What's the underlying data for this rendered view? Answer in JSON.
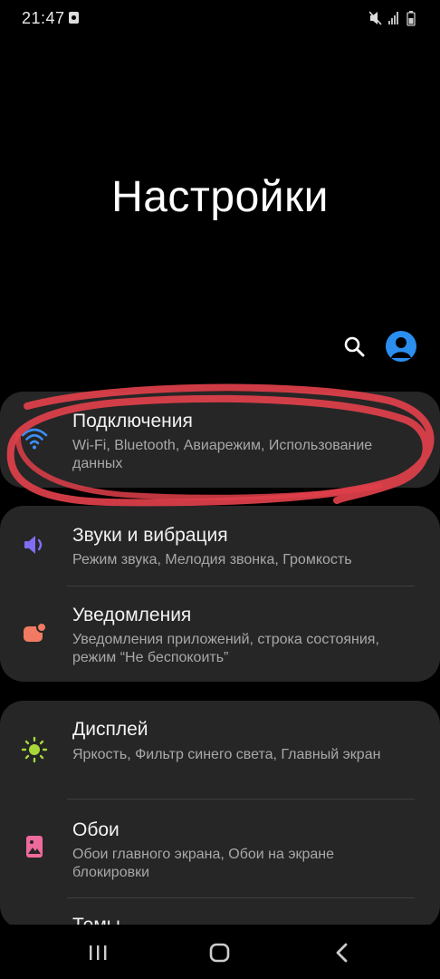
{
  "status_bar": {
    "time": "21:47"
  },
  "title": "Настройки",
  "header": {
    "search_icon": "search-icon",
    "account_icon": "account-icon"
  },
  "items": [
    {
      "title": "Подключения",
      "subtitle": "Wi-Fi, Bluetooth, Авиарежим, Использование данных",
      "icon": "wifi-icon",
      "icon_color": "#3d8ef5"
    },
    {
      "title": "Звуки и вибрация",
      "subtitle": "Режим звука, Мелодия звонка, Громкость",
      "icon": "volume-icon",
      "icon_color": "#7f6df2"
    },
    {
      "title": "Уведомления",
      "subtitle": "Уведомления приложений, строка состояния, режим “Не беспокоить”",
      "icon": "notifications-icon",
      "icon_color": "#f07a62"
    },
    {
      "title": "Дисплей",
      "subtitle": "Яркость, Фильтр синего света, Главный экран",
      "icon": "brightness-icon",
      "icon_color": "#a6d83a"
    },
    {
      "title": "Обои",
      "subtitle": "Обои главного экрана, Обои на экране блокировки",
      "icon": "wallpaper-icon",
      "icon_color": "#ee6a9c"
    },
    {
      "title": "Темы",
      "icon": "themes-icon"
    }
  ],
  "annotation_color": "#e0404a",
  "nav": {
    "recents": "recents-icon",
    "home": "home-icon",
    "back": "back-icon"
  }
}
